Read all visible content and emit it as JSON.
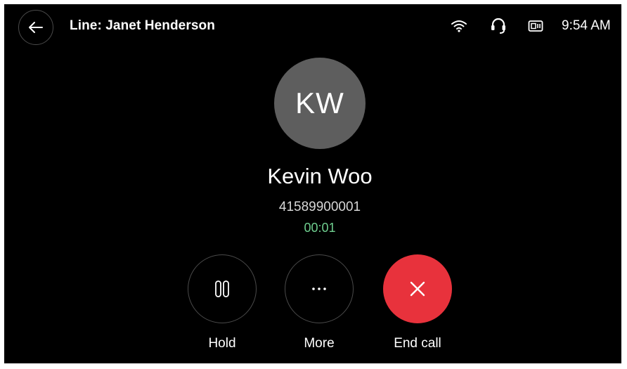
{
  "header": {
    "title": "Line: Janet Henderson",
    "time": "9:54 AM",
    "icons": [
      "back-arrow-icon",
      "wifi-icon",
      "headset-icon",
      "device-icon"
    ]
  },
  "call": {
    "initials": "KW",
    "name": "Kevin Woo",
    "number": "41589900001",
    "duration": "00:01"
  },
  "actions": {
    "hold_label": "Hold",
    "more_label": "More",
    "end_label": "End call"
  },
  "colors": {
    "background": "#000000",
    "avatar": "#5e5e5e",
    "timer": "#6fcf8f",
    "end_call": "#e8323c",
    "button_border": "#4a4a4a"
  }
}
